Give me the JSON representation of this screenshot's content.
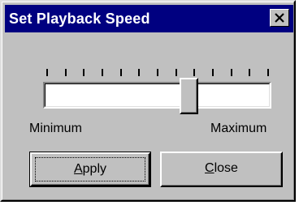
{
  "window": {
    "title": "Set Playback Speed",
    "close_icon": "close-x-icon"
  },
  "slider": {
    "tick_count": 13,
    "value_fraction": 0.65,
    "min_label": "Minimum",
    "max_label": "Maximum"
  },
  "buttons": {
    "apply": {
      "mnemonic": "A",
      "rest": "pply"
    },
    "close": {
      "mnemonic": "C",
      "rest": "lose"
    }
  },
  "colors": {
    "titlebar": "#000080",
    "face": "#c0c0c0"
  }
}
